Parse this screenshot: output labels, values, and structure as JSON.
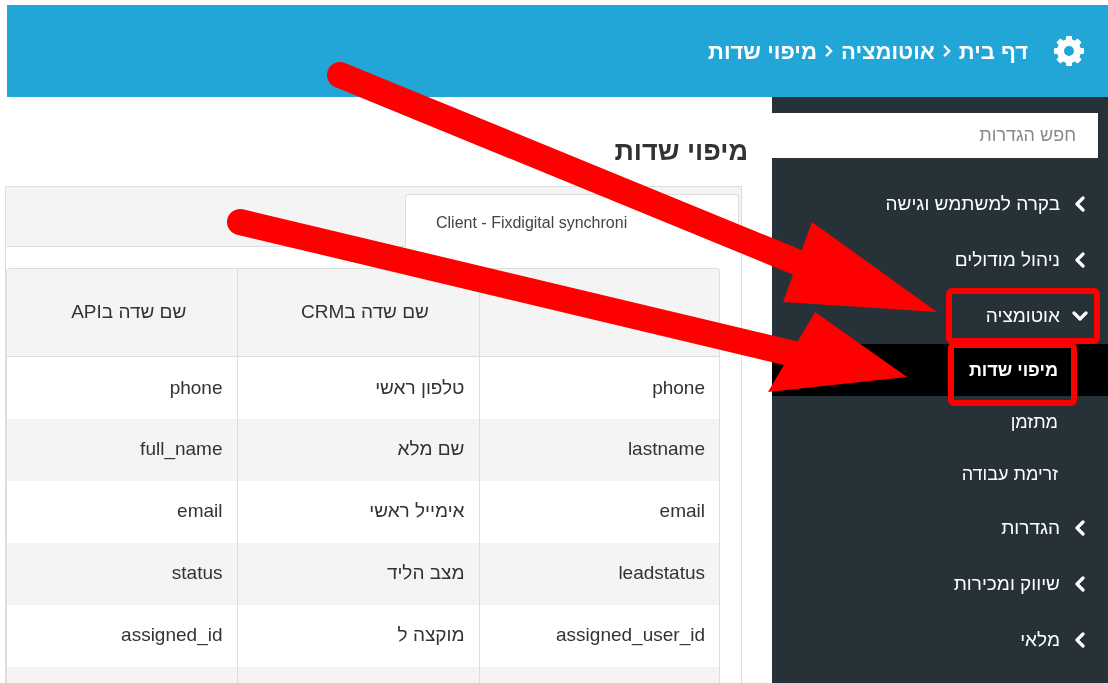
{
  "header": {
    "breadcrumbs": [
      {
        "label": "דף בית"
      },
      {
        "label": "אוטומציה"
      },
      {
        "label": "מיפוי שדות"
      }
    ]
  },
  "sidebar": {
    "search": {
      "placeholder": "חפש הגדרות"
    },
    "items": [
      {
        "label": "בקרה למשתמש וגישה",
        "expanded": false,
        "highlighted": false
      },
      {
        "label": "ניהול מודולים",
        "expanded": false,
        "highlighted": false
      },
      {
        "label": "אוטומציה",
        "expanded": true,
        "highlighted": true,
        "children": [
          {
            "label": "מיפוי שדות",
            "selected": true,
            "highlighted": true
          },
          {
            "label": "מתזמן",
            "selected": false,
            "highlighted": false
          },
          {
            "label": "זרימת עבודה",
            "selected": false,
            "highlighted": false
          }
        ]
      },
      {
        "label": "הגדרות",
        "expanded": false,
        "highlighted": false
      },
      {
        "label": "שיווק ומכירות",
        "expanded": false,
        "highlighted": false
      },
      {
        "label": "מלאי",
        "expanded": false,
        "highlighted": false
      }
    ]
  },
  "page_title": "מיפוי שדות",
  "tabs": [
    {
      "label": "Client - Fixdigital synchroni",
      "selected": true
    }
  ],
  "table": {
    "column_headers": {
      "column_2": "שם שדה בCRM",
      "column_3": "שם שדה בAPI"
    },
    "rows": [
      [
        "phone",
        "טלפון ראשי",
        "phone"
      ],
      [
        "lastname",
        "שם מלא",
        "full_name"
      ],
      [
        "email",
        "אימייל ראשי",
        "email"
      ],
      [
        "leadstatus",
        "מצב הליד",
        "status"
      ],
      [
        "assigned_user_id",
        "מוקצה ל",
        "assigned_id"
      ]
    ]
  },
  "annotations": [
    {
      "kind": "arrow"
    },
    {
      "kind": "arrow"
    }
  ]
}
